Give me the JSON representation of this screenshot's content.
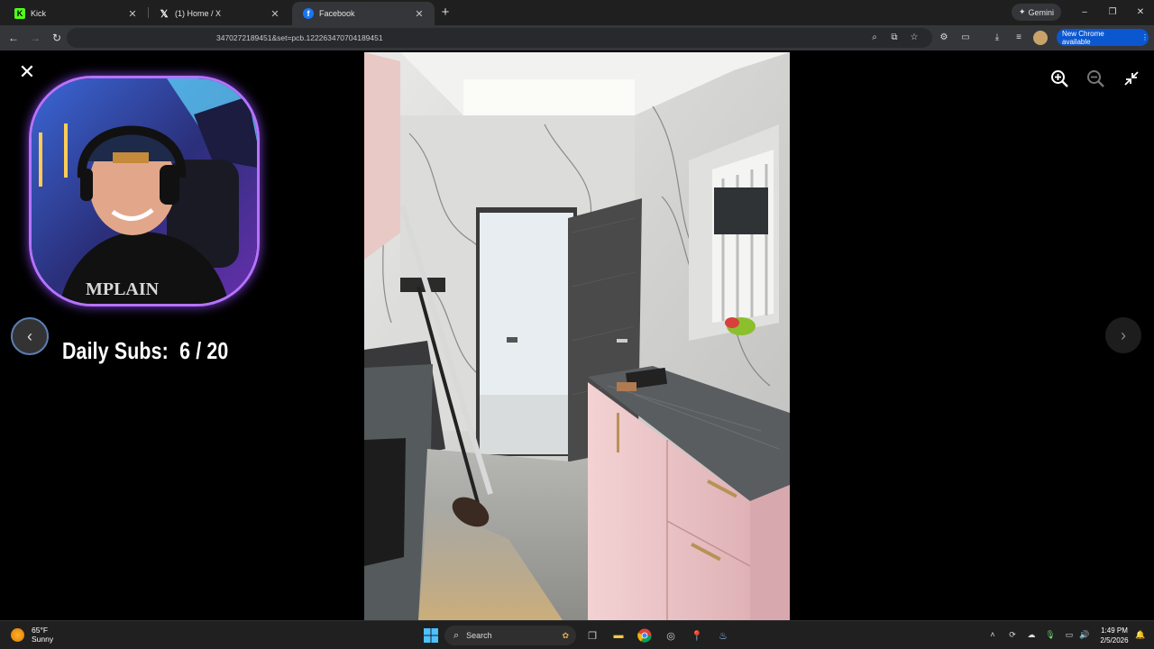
{
  "tabs": [
    {
      "title": "Kick",
      "icon": "kick-icon",
      "color": "#53fc18",
      "active": false
    },
    {
      "title": "(1) Home / X",
      "icon": "x-icon",
      "color": "#ffffff",
      "active": false
    },
    {
      "title": "Facebook",
      "icon": "facebook-icon",
      "color": "#1877f2",
      "active": true
    }
  ],
  "new_tab_symbol": "+",
  "gemini_label": "Gemini",
  "window_controls": {
    "minimize": "–",
    "restore": "❐",
    "close": "✕"
  },
  "address_bar": {
    "url_fragment": "3470272189451&set=pcb.122263470704189451"
  },
  "update_button": {
    "label": "New Chrome available"
  },
  "viewer": {
    "close_symbol": "✕",
    "prev_symbol": "‹",
    "next_symbol": "›"
  },
  "overlay": {
    "daily_subs_label": "Daily Subs:",
    "daily_subs_value": "6 / 20",
    "shirt_text": "MPLAIN"
  },
  "taskbar": {
    "weather_temp": "65°F",
    "weather_desc": "Sunny",
    "search_placeholder": "Search",
    "time": "1:49 PM",
    "date": "2/5/2026"
  },
  "colors": {
    "accent_blue": "#0b57d0",
    "webcam_border": "#b673ff",
    "tab_bg": "#1f1f1f",
    "toolbar_bg": "#35363a"
  }
}
